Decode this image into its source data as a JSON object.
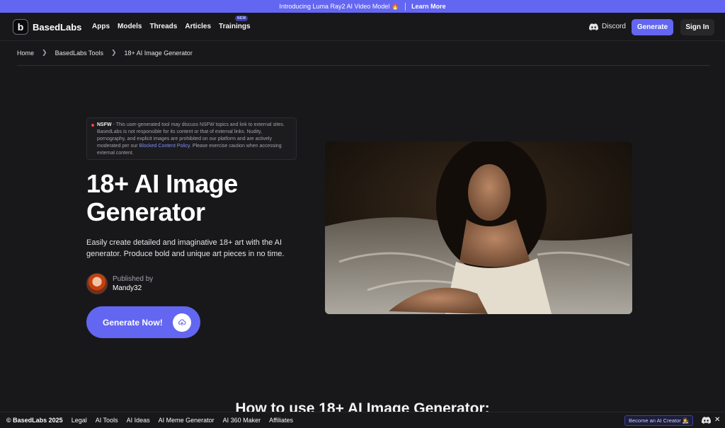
{
  "announcement": {
    "text": "Introducing Luma Ray2 AI Video Model 🔥",
    "link": "Learn More"
  },
  "nav": {
    "logo": "BasedLabs",
    "items": [
      "Apps",
      "Models",
      "Threads",
      "Articles",
      "Trainings"
    ],
    "new_badge": "NEW",
    "discord": "Discord",
    "generate": "Generate",
    "signin": "Sign In"
  },
  "breadcrumb": [
    "Home",
    "BasedLabs Tools",
    "18+ AI Image Generator"
  ],
  "notice": {
    "label": "NSFW",
    "text": " - This user-generated tool may discuss NSFW topics and link to external sites. BasedLabs is not responsible for its content or that of external links. Nudity, pornography, and explicit images are prohibited on our platform and are actively moderated per our ",
    "link": "Blocked Content Policy",
    "tail": ". Please exercise caution when accessing external content."
  },
  "hero": {
    "title": "18+ AI Image Generator",
    "description": "Easily create detailed and imaginative 18+ art with the AI generator. Produce bold and unique art pieces in no time.",
    "published_label": "Published by",
    "author": "Mandy32",
    "cta": "Generate Now!"
  },
  "section_heading": "How to use 18+ AI Image Generator:",
  "footer": {
    "copyright": "© BasedLabs 2025",
    "links": [
      "Legal",
      "AI Tools",
      "AI Ideas",
      "AI Meme Generator",
      "AI 360 Maker",
      "Affiliates"
    ],
    "creator_button": "Become an AI Creator 👩‍🎨"
  },
  "colors": {
    "accent": "#6366f1",
    "background": "#18181b",
    "danger": "#ef4444"
  }
}
